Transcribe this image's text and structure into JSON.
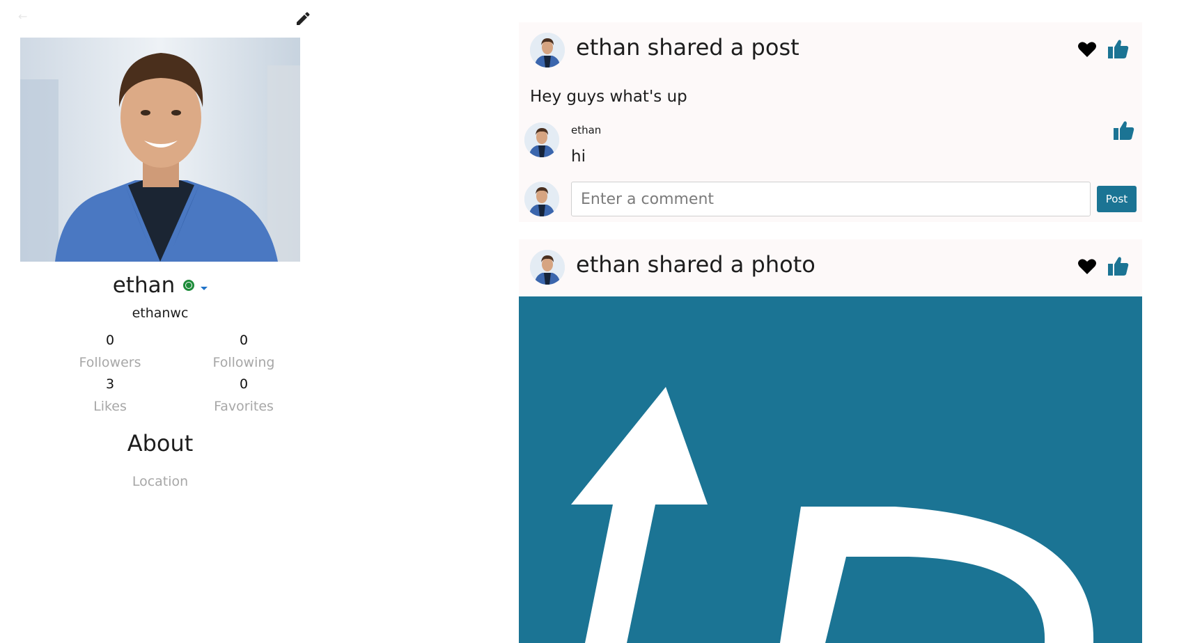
{
  "profile": {
    "name": "ethan",
    "username": "ethanwc",
    "status_color": "#1e8c3a",
    "stats": [
      {
        "value": "0",
        "label": "Followers"
      },
      {
        "value": "0",
        "label": "Following"
      },
      {
        "value": "3",
        "label": "Likes"
      },
      {
        "value": "0",
        "label": "Favorites"
      }
    ],
    "about_title": "About",
    "location_label": "Location"
  },
  "feed": {
    "posts": [
      {
        "title": "ethan shared a post",
        "text": "Hey guys what's up",
        "comments": [
          {
            "author": "ethan",
            "text": "hi"
          }
        ],
        "comment_placeholder": "Enter a comment",
        "post_button": "Post"
      },
      {
        "title": "ethan shared a photo"
      }
    ]
  },
  "colors": {
    "accent": "#1b7494",
    "status": "#1e8c3a",
    "card_bg": "#fdf9f9",
    "muted_text": "#a7a7a7"
  },
  "icons": [
    "back-arrow-icon",
    "pencil-icon",
    "status-online-icon",
    "caret-down-icon",
    "heart-icon",
    "thumbs-up-icon"
  ]
}
